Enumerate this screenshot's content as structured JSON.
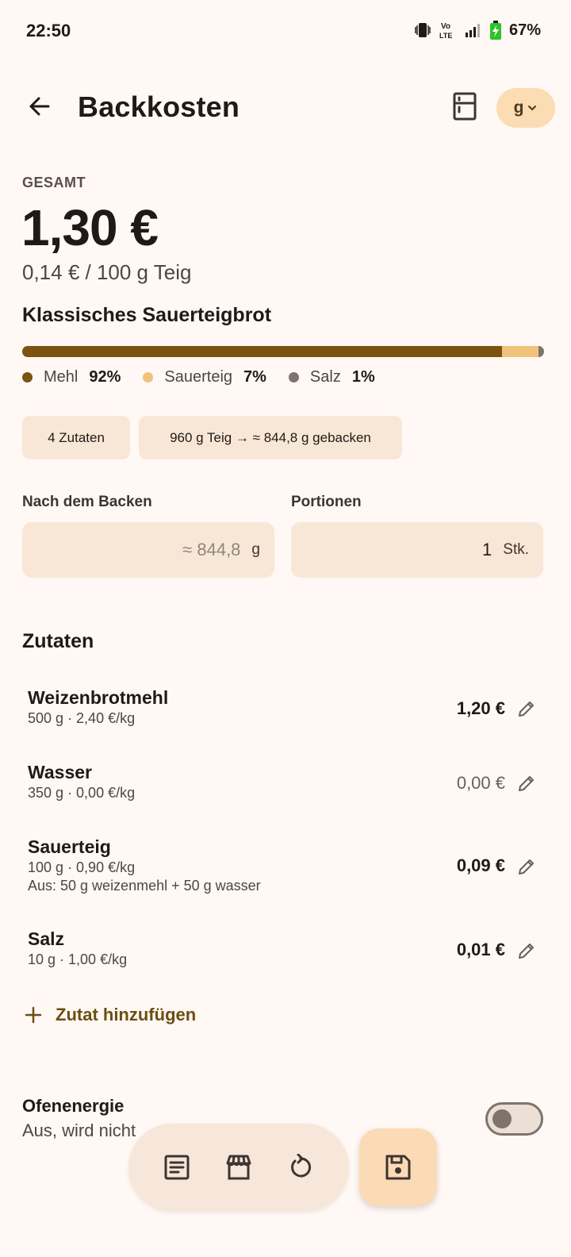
{
  "status_bar": {
    "time": "22:50",
    "network_label": "Vo LTE",
    "battery": "67%"
  },
  "app_bar": {
    "title": "Backkosten",
    "unit_chip": "g"
  },
  "summary": {
    "overline": "GESAMT",
    "total": "1,30 €",
    "per_100g": "0,14 € / 100 g Teig",
    "recipe_name": "Klassisches Sauerteigbrot"
  },
  "cost_breakdown": {
    "segments": [
      {
        "name": "Mehl",
        "percent_label": "92%",
        "fraction": 0.92,
        "color": "#7a5410"
      },
      {
        "name": "Sauerteig",
        "percent_label": "7%",
        "fraction": 0.07,
        "color": "#f0c27a"
      },
      {
        "name": "Salz",
        "percent_label": "1%",
        "fraction": 0.01,
        "color": "#7d746b"
      }
    ]
  },
  "chips": {
    "ingredients_count": "4 Zutaten",
    "dough_weight": "960 g Teig → ≈ 844,8 g gebacken"
  },
  "fields": {
    "after_baking_label": "Nach dem Backen",
    "after_baking_value": "≈ 844,8",
    "after_baking_unit": "g",
    "portions_label": "Portionen",
    "portions_value": "1",
    "portions_unit": "Stk."
  },
  "ingredients_section": {
    "title": "Zutaten",
    "items": [
      {
        "name": "Weizenbrotmehl",
        "detail": "500 g · 2,40 €/kg",
        "note": "",
        "price": "1,20 €"
      },
      {
        "name": "Wasser",
        "detail": "350 g · 0,00 €/kg",
        "note": "",
        "price": "0,00 €"
      },
      {
        "name": "Sauerteig",
        "detail": "100 g · 0,90 €/kg",
        "note": "Aus: 50 g weizenmehl + 50 g wasser",
        "price": "0,09 €"
      },
      {
        "name": "Salz",
        "detail": "10 g · 1,00 €/kg",
        "note": "",
        "price": "0,01 €"
      }
    ],
    "add_label": "Zutat hinzufügen"
  },
  "oven": {
    "title": "Ofenenergie",
    "subtitle": "Aus, wird nicht"
  },
  "icons": {
    "back": "arrow-left-icon",
    "kitchen": "fridge-icon",
    "unit_dropdown": "chevron-down-icon",
    "recipe": "document-icon",
    "store": "storefront-icon",
    "reset": "refresh-icon",
    "save": "floppy-icon",
    "edit": "pencil-icon",
    "add": "plus-icon"
  }
}
